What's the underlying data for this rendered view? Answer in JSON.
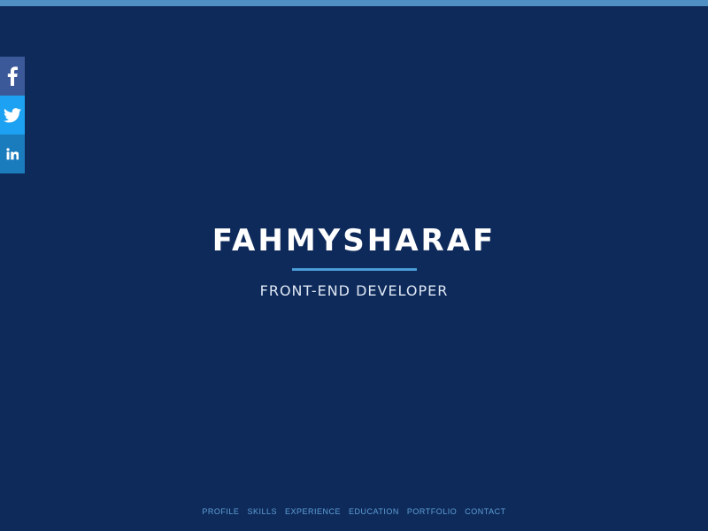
{
  "social": [
    {
      "name": "facebook",
      "icon": "facebook-icon",
      "color": "#3b5998"
    },
    {
      "name": "twitter",
      "icon": "twitter-icon",
      "color": "#1da1f2"
    },
    {
      "name": "linkedin",
      "icon": "linkedin-icon",
      "color": "#1a7bbd"
    }
  ],
  "hero": {
    "title": "FAHMYSHARAF",
    "subtitle": "FRONT-END DEVELOPER"
  },
  "nav": {
    "items": [
      {
        "label": "PROFILE"
      },
      {
        "label": "SKILLS"
      },
      {
        "label": "EXPERIENCE"
      },
      {
        "label": "EDUCATION"
      },
      {
        "label": "PORTFOLIO"
      },
      {
        "label": "CONTACT"
      }
    ]
  },
  "colors": {
    "background": "#0e2a5a",
    "top_bar": "#4f8fc4",
    "accent": "#4a9bd6",
    "nav_text": "#5e9fd6"
  }
}
